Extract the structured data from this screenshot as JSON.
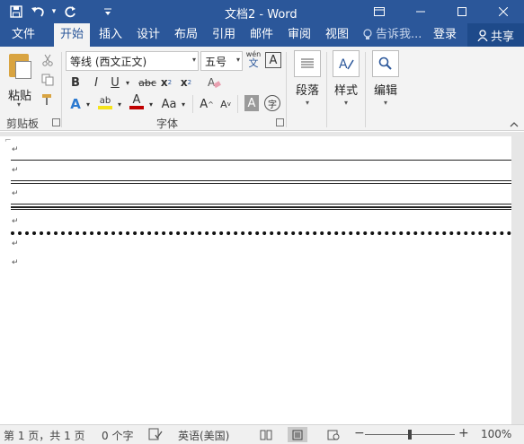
{
  "titlebar": {
    "title": "文档2 - Word",
    "save_icon": "save-icon",
    "undo_icon": "undo-icon",
    "redo_icon": "redo-icon",
    "customize_icon": "customize-qat-icon",
    "bg_color": "#2b579a"
  },
  "tabs": [
    {
      "label": "文件"
    },
    {
      "label": "开始"
    },
    {
      "label": "插入"
    },
    {
      "label": "设计"
    },
    {
      "label": "布局"
    },
    {
      "label": "引用"
    },
    {
      "label": "邮件"
    },
    {
      "label": "审阅"
    },
    {
      "label": "视图"
    }
  ],
  "tellme": "告诉我...",
  "signin": "登录",
  "share": "共享",
  "ribbon": {
    "clipboard": {
      "paste_label": "粘贴",
      "group_label": "剪贴板"
    },
    "font": {
      "font_name": "等线 (西文正文)",
      "font_size": "五号",
      "wen_label": "wén",
      "wen_char": "文",
      "a_box": "A",
      "bold": "B",
      "italic": "I",
      "underline": "U",
      "strike": "abc",
      "subscript_base": "x",
      "subscript_mark": "2",
      "superscript_base": "x",
      "superscript_mark": "2",
      "text_effects": "A",
      "highlight": "ab",
      "font_color": "A",
      "change_case": "Aa",
      "grow": "A",
      "shrink": "A",
      "char_shading": "A",
      "enclose": "字",
      "group_label": "字体"
    },
    "paragraph_label": "段落",
    "styles_label": "样式",
    "editing_label": "编辑"
  },
  "status": {
    "page": "第 1 页，共 1 页",
    "words": "0 个字",
    "language": "英语(美国)",
    "zoom_minus": "−",
    "zoom_plus": "+",
    "zoom": "100%",
    "zoom_value": 100
  }
}
